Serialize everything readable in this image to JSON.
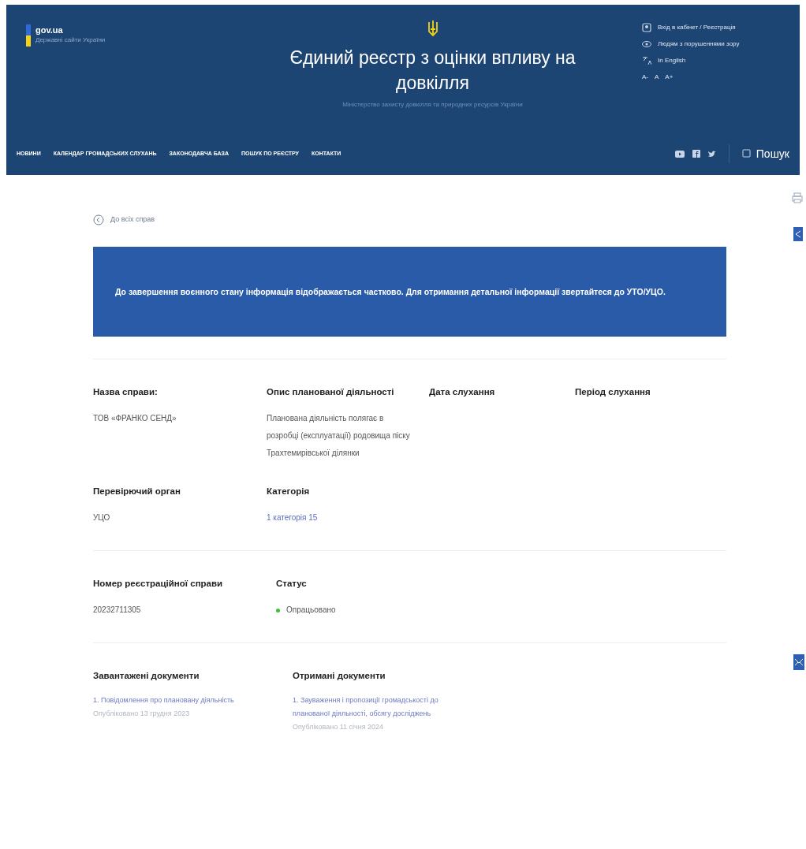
{
  "header": {
    "brand": "gov.ua",
    "brand_subtitle": "Державні сайти України",
    "title": "Єдиний реєстр з оцінки впливу на довкілля",
    "subtitle": "Міністерство захисту довкілля та природних ресурсів України",
    "links": [
      {
        "kind": "login",
        "label": "Вхід в кабінет / Реєстрація"
      },
      {
        "kind": "eye",
        "label": "Людям з порушеннями зору"
      },
      {
        "kind": "lang",
        "label": "In English"
      }
    ],
    "font_sizes": [
      "A-",
      "A",
      "A+"
    ],
    "nav": [
      "НОВИНИ",
      "КАЛЕНДАР ГРОМАДСЬКИХ СЛУХАНЬ",
      "ЗАКОНОДАВЧА БАЗА",
      "ПОШУК ПО РЕЄСТРУ",
      "КОНТАКТИ"
    ],
    "search": "Пошук"
  },
  "back_link": "До всіх справ",
  "notice": "До завершення воєнного стану інформація відображається частково. Для отримання детальної інформації звертайтеся до УТО/УЦО.",
  "sections": [
    {
      "fields": [
        {
          "label": "Назва справи:",
          "value": "ТОВ «ФРАНКО СЕНД»"
        },
        {
          "label": "Опис планованої діяльності",
          "value": "Планована діяльність полягає в розробці (експлуатації) родовища піску Трахтемирівської ділянки"
        },
        {
          "label": "Дата слухання"
        },
        {
          "label": "Період слухання"
        },
        {
          "label": "Перевірючий орган",
          "value": "УЦО"
        },
        {
          "label": "Категорія",
          "value": "1 категорія 15",
          "kind": "link"
        }
      ]
    },
    {
      "fields": [
        {
          "label": "Номер реєстраційної справи",
          "value": "20232711305"
        },
        {
          "label": "Статус",
          "value": "Опрацьовано",
          "kind": "status",
          "color": "#3cc13b"
        }
      ]
    }
  ],
  "documents": [
    {
      "title": "Завантажені документи",
      "items": [
        {
          "name": "1. Повідомлення про плановану діяльність",
          "date": "Опубліковано 13 грудня 2023"
        }
      ]
    },
    {
      "title": "Отримані документи",
      "items": [
        {
          "name": "1. Зауваження і пропозиції громадськості до планованої діяльності, обсягу досліджень",
          "date": "Опубліковано 11 січня 2024"
        }
      ]
    }
  ]
}
